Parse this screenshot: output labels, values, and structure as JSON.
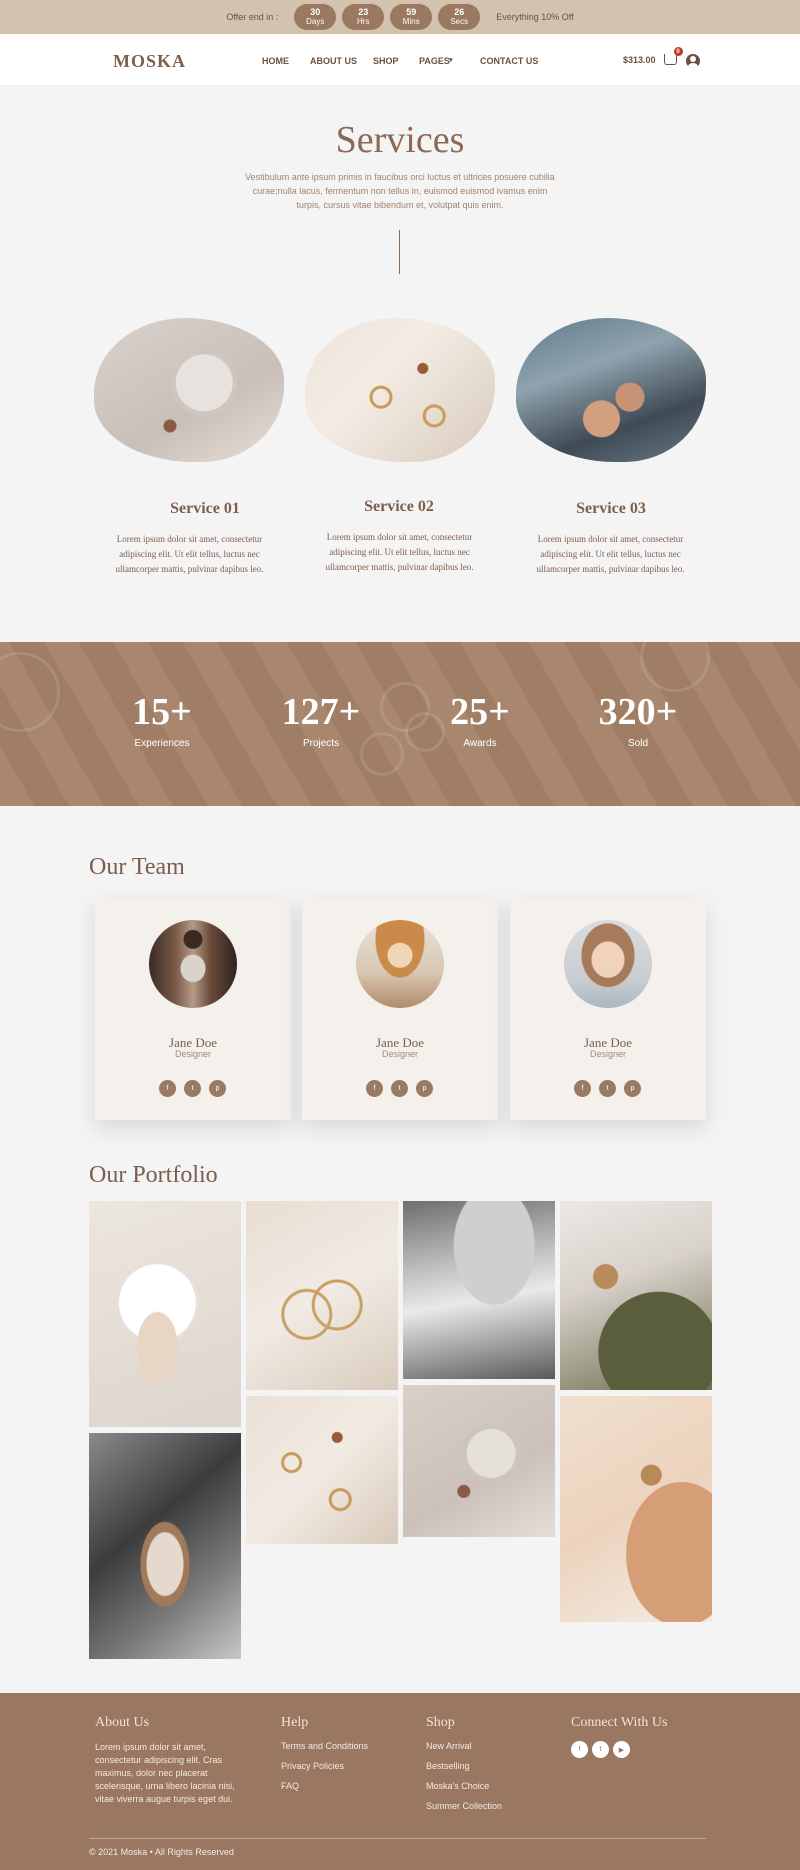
{
  "topbar": {
    "offer_label": "Offer end in :",
    "countdown": [
      {
        "value": "30",
        "unit": "Days"
      },
      {
        "value": "23",
        "unit": "Hrs"
      },
      {
        "value": "59",
        "unit": "Mins"
      },
      {
        "value": "26",
        "unit": "Secs"
      }
    ],
    "promo": "Everything 10% Off"
  },
  "header": {
    "logo": "MOSKA",
    "nav": [
      "HOME",
      "ABOUT US",
      "SHOP",
      "PAGES",
      "CONTACT US"
    ],
    "cart_total": "$313.00",
    "cart_count": "0"
  },
  "services": {
    "title": "Services",
    "description": "Vestibulum ante ipsum primis in faucibus orci luctus et ultrices posuere cubilia curae;nulla lacus, fermentum non tellus in, euismod euismod ivamus enim turpis, cursus vitae bibendum et, volutpat quis enim.",
    "items": [
      {
        "name": "Service 01",
        "text": "Lorem ipsum dolor sit amet, consectetur adipiscing elit. Ut elit tellus, luctus nec ullamcorper mattis, pulvinar dapibus leo."
      },
      {
        "name": "Service 02",
        "text": "Lorem ipsum dolor sit amet, consectetur adipiscing elit. Ut elit tellus, luctus nec ullamcorper mattis, pulvinar dapibus leo."
      },
      {
        "name": "Service 03",
        "text": "Lorem ipsum dolor sit amet, consectetur adipiscing elit. Ut elit tellus, luctus nec ullamcorper mattis, pulvinar dapibus leo."
      }
    ]
  },
  "stats": [
    {
      "number": "15+",
      "label": "Experiences"
    },
    {
      "number": "127+",
      "label": "Projects"
    },
    {
      "number": "25+",
      "label": "Awards"
    },
    {
      "number": "320+",
      "label": "Sold"
    }
  ],
  "team": {
    "title": "Our Team",
    "members": [
      {
        "name": "Jane Doe",
        "role": "Designer"
      },
      {
        "name": "Jane Doe",
        "role": "Designer"
      },
      {
        "name": "Jane Doe",
        "role": "Designer"
      }
    ]
  },
  "portfolio": {
    "title": "Our Portfolio"
  },
  "footer": {
    "about": {
      "title": "About Us",
      "text": "Lorem ipsum dolor sit amet, consectetur adipiscing elit. Cras maximus, dolor nec placerat scelerisque, urna libero lacinia nisi, vitae viverra augue turpis eget dui."
    },
    "help": {
      "title": "Help",
      "links": [
        "Terms and Conditions",
        "Privacy Policies",
        "FAQ"
      ]
    },
    "shop": {
      "title": "Shop",
      "links": [
        "New Arrival",
        "Bestselling",
        "Moska's Choice",
        "Summer Collection"
      ]
    },
    "connect": {
      "title": "Connect With Us"
    },
    "copyright": "© 2021 Moska • All Rights Reserved"
  }
}
